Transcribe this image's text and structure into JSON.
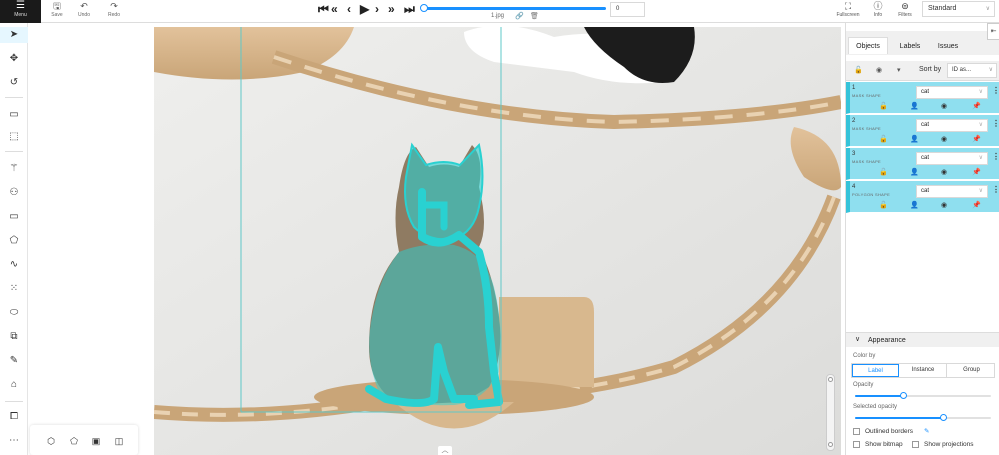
{
  "topbar": {
    "menu_label": "Menu",
    "save_label": "Save",
    "undo_label": "Undo",
    "redo_label": "Redo",
    "frame_value": "0",
    "filename": "1.jpg",
    "fullscreen_label": "Fullscreen",
    "info_label": "Info",
    "filters_label": "Filters",
    "workspace_value": "Standard"
  },
  "player": {
    "first": "⏮",
    "prev_step": "«",
    "prev": "‹",
    "play": "▶",
    "next": "›",
    "next_step": "»",
    "last": "⏭",
    "progress_fraction": 0
  },
  "sidebar": {
    "tabs": [
      "Objects",
      "Labels",
      "Issues"
    ],
    "sort_label": "Sort by",
    "sort_value": "ID as...",
    "objects": [
      {
        "id": "1",
        "type": "MASK SHAPE",
        "label": "cat"
      },
      {
        "id": "2",
        "type": "MASK SHAPE",
        "label": "cat"
      },
      {
        "id": "3",
        "type": "MASK SHAPE",
        "label": "cat"
      },
      {
        "id": "4",
        "type": "POLYGON SHAPE",
        "label": "cat"
      }
    ],
    "object_color": "#8fdfef"
  },
  "appearance": {
    "title": "Appearance",
    "color_by_label": "Color by",
    "color_by_options": [
      "Label",
      "Instance",
      "Group"
    ],
    "color_by_selected": "Label",
    "opacity_label": "Opacity",
    "opacity_value": 0.35,
    "selected_opacity_label": "Selected opacity",
    "selected_opacity_value": 0.65,
    "outlined_borders_label": "Outlined borders",
    "show_bitmap_label": "Show bitmap",
    "show_projections_label": "Show projections"
  },
  "colors": {
    "accent": "#1890ff",
    "mask": "#29d1d1"
  }
}
